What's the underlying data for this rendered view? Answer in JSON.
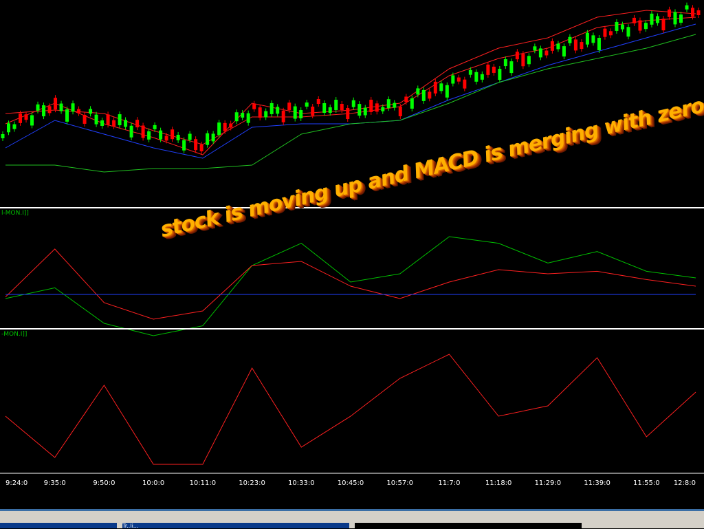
{
  "window": {
    "title": ""
  },
  "panes": {
    "macd_label": "l-MON.I]]",
    "hist_label": "-MON.I]]"
  },
  "annotation": {
    "text": "stock is moving up and MACD is merging with zero ????"
  },
  "colors": {
    "background": "#000000",
    "candle_up": "#00ff00",
    "candle_down": "#ff0000",
    "band_upper_lower": "#ff2020",
    "band_middle": "#00c000",
    "ma_blue": "#2040ff",
    "ma_green": "#20c020",
    "macd_line": "#00c000",
    "signal_line": "#ff2020",
    "zero_line": "#2040ff",
    "histogram": "#ff2020",
    "annotation": "#ffb000",
    "taskbar_blue": "#0a3a8a"
  },
  "chart_data": [
    {
      "type": "line",
      "title": "",
      "x": [
        "9:24:0",
        "9:35:0",
        "9:50:0",
        "10:0:0",
        "10:11:0",
        "10:23:0",
        "10:33:0",
        "10:45:0",
        "10:57:0",
        "11:7:0",
        "11:18:0",
        "11:29:0",
        "11:39:0",
        "11:55:0",
        "12:8:0"
      ],
      "series": [
        {
          "values": [
            180,
            150,
            180,
            200,
            225,
            150,
            165,
            160,
            150,
            100,
            70,
            55,
            25,
            15,
            20
          ]
        },
        {
          "values": [
            165,
            160,
            165,
            190,
            210,
            170,
            170,
            165,
            155,
            110,
            85,
            70,
            40,
            30,
            25
          ]
        },
        {
          "values": [
            215,
            175,
            195,
            215,
            230,
            185,
            180,
            180,
            175,
            145,
            120,
            95,
            75,
            55,
            35
          ]
        },
        {
          "values": [
            240,
            240,
            250,
            245,
            245,
            240,
            195,
            180,
            175,
            150,
            120,
            100,
            85,
            70,
            50
          ]
        }
      ]
    },
    {
      "type": "line",
      "title": "",
      "x": [
        "9:24:0",
        "9:35:0",
        "9:50:0",
        "10:0:0",
        "10:11:0",
        "10:23:0",
        "10:33:0",
        "10:45:0",
        "10:57:0",
        "11:7:0",
        "11:18:0",
        "11:29:0",
        "11:39:0",
        "11:55:0",
        "12:8:0"
      ],
      "series": [
        {
          "values": [
            -5,
            8,
            -35,
            -50,
            -38,
            35,
            62,
            15,
            25,
            70,
            62,
            38,
            52,
            28,
            20
          ]
        },
        {
          "values": [
            -3,
            55,
            -10,
            -30,
            -20,
            35,
            40,
            10,
            -5,
            15,
            30,
            25,
            28,
            18,
            10
          ]
        },
        {
          "values": [
            0,
            0,
            0,
            0,
            0,
            0,
            0,
            0,
            0,
            0,
            0,
            0,
            0,
            0,
            0
          ]
        }
      ]
    },
    {
      "type": "line",
      "title": "",
      "x": [
        "9:24:0",
        "9:35:0",
        "9:50:0",
        "10:0:0",
        "10:11:0",
        "10:23:0",
        "10:33:0",
        "10:45:0",
        "10:57:0",
        "11:7:0",
        "11:18:0",
        "11:29:0",
        "11:39:0",
        "11:55:0",
        "12:8:0"
      ],
      "series": [
        {
          "values": [
            95,
            35,
            140,
            25,
            25,
            165,
            50,
            95,
            150,
            185,
            95,
            110,
            180,
            65,
            130
          ]
        }
      ]
    }
  ],
  "taskbar": {
    "items": [
      "",
      "Tr..li...",
      ""
    ]
  }
}
